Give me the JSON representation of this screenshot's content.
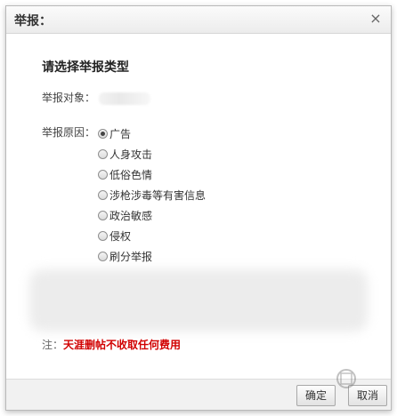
{
  "dialog": {
    "title": "举报：",
    "close_icon": "close-icon",
    "heading": "请选择举报类型",
    "target_label": "举报对象：",
    "reason_label": "举报原因：",
    "reasons": [
      {
        "label": "广告",
        "selected": true
      },
      {
        "label": "人身攻击",
        "selected": false
      },
      {
        "label": "低俗色情",
        "selected": false
      },
      {
        "label": "涉枪涉毒等有害信息",
        "selected": false
      },
      {
        "label": "政治敏感",
        "selected": false
      },
      {
        "label": "侵权",
        "selected": false
      },
      {
        "label": "刷分举报",
        "selected": false
      }
    ],
    "note_prefix": "注：",
    "note_text": "天涯删帖不收取任何费用",
    "ok_label": "确定",
    "cancel_label": "取消"
  },
  "colors": {
    "warning": "#d10000",
    "border": "#b9b9b9"
  }
}
